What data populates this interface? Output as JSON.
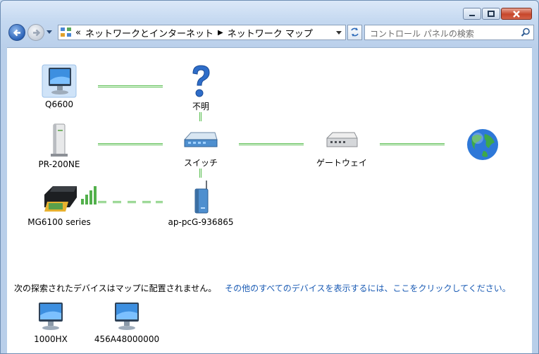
{
  "window": {
    "buttons": {
      "minimize": "minimize",
      "maximize": "maximize",
      "close": "close"
    }
  },
  "nav": {
    "breadcrumb": [
      "«",
      "ネットワークとインターネット",
      "ネットワーク マップ"
    ],
    "search_placeholder": "コントロール パネルの検索"
  },
  "map": {
    "nodes": {
      "q6600": "Q6600",
      "unknown": "不明",
      "pr200ne": "PR-200NE",
      "switch": "スイッチ",
      "gateway": "ゲートウェイ",
      "mg6100": "MG6100 series",
      "ap": "ap-pcG-936865"
    }
  },
  "unmapped": {
    "message": "次の探索されたデバイスはマップに配置されません。",
    "link": "その他のすべてのデバイスを表示するには、ここをクリックしてください。",
    "devices": [
      "1000HX",
      "456A48000000"
    ]
  },
  "icons": {
    "computer": "computer-icon",
    "unknown": "question-mark-icon",
    "router": "router-icon",
    "switch": "switch-icon",
    "printer": "printer-icon",
    "access_point": "access-point-icon",
    "internet": "globe-icon"
  }
}
